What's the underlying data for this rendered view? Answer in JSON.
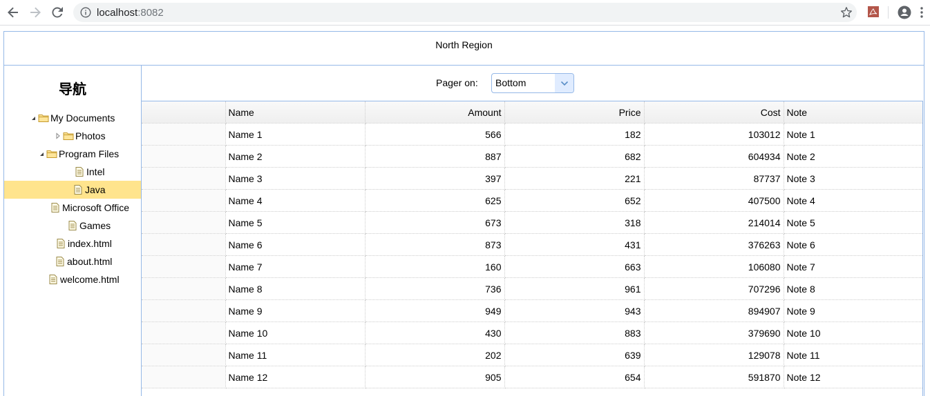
{
  "browser": {
    "url_host": "localhost",
    "url_port": ":8082"
  },
  "north": {
    "title": "North Region"
  },
  "west": {
    "title": "导航",
    "tree": [
      {
        "label": "My Documents",
        "type": "folder",
        "expanded": true,
        "depth": 0
      },
      {
        "label": "Photos",
        "type": "folder",
        "expanded": false,
        "depth": 1
      },
      {
        "label": "Program Files",
        "type": "folder",
        "expanded": true,
        "depth": 1
      },
      {
        "label": "Intel",
        "type": "file",
        "depth": 2
      },
      {
        "label": "Java",
        "type": "file",
        "depth": 2,
        "selected": true
      },
      {
        "label": "Microsoft Office",
        "type": "file",
        "depth": 1
      },
      {
        "label": "Games",
        "type": "file",
        "depth": 1
      },
      {
        "label": "index.html",
        "type": "file",
        "depth": 0
      },
      {
        "label": "about.html",
        "type": "file",
        "depth": 0
      },
      {
        "label": "welcome.html",
        "type": "file",
        "depth": 0
      }
    ]
  },
  "pager": {
    "label": "Pager on:",
    "selected": "Bottom"
  },
  "grid": {
    "columns": [
      "",
      "Name",
      "Amount",
      "Price",
      "Cost",
      "Note"
    ],
    "rows": [
      [
        "Name 1",
        "566",
        "182",
        "103012",
        "Note 1"
      ],
      [
        "Name 2",
        "887",
        "682",
        "604934",
        "Note 2"
      ],
      [
        "Name 3",
        "397",
        "221",
        "87737",
        "Note 3"
      ],
      [
        "Name 4",
        "625",
        "652",
        "407500",
        "Note 4"
      ],
      [
        "Name 5",
        "673",
        "318",
        "214014",
        "Note 5"
      ],
      [
        "Name 6",
        "873",
        "431",
        "376263",
        "Note 6"
      ],
      [
        "Name 7",
        "160",
        "663",
        "106080",
        "Note 7"
      ],
      [
        "Name 8",
        "736",
        "961",
        "707296",
        "Note 8"
      ],
      [
        "Name 9",
        "949",
        "943",
        "894907",
        "Note 9"
      ],
      [
        "Name 10",
        "430",
        "883",
        "379690",
        "Note 10"
      ],
      [
        "Name 11",
        "202",
        "639",
        "129078",
        "Note 11"
      ],
      [
        "Name 12",
        "905",
        "654",
        "591870",
        "Note 12"
      ]
    ]
  },
  "colors": {
    "border": "#95b8e7",
    "selected_bg": "#ffe48d",
    "header_bg": "#efefef"
  },
  "icons": {
    "back": "back-arrow-icon",
    "forward": "forward-arrow-icon",
    "reload": "reload-icon",
    "info": "info-icon",
    "star": "bookmark-star-icon",
    "pdf": "pdf-extension-icon",
    "account": "account-icon",
    "menu": "kebab-menu-icon",
    "folder": "folder-icon",
    "file": "file-icon"
  }
}
